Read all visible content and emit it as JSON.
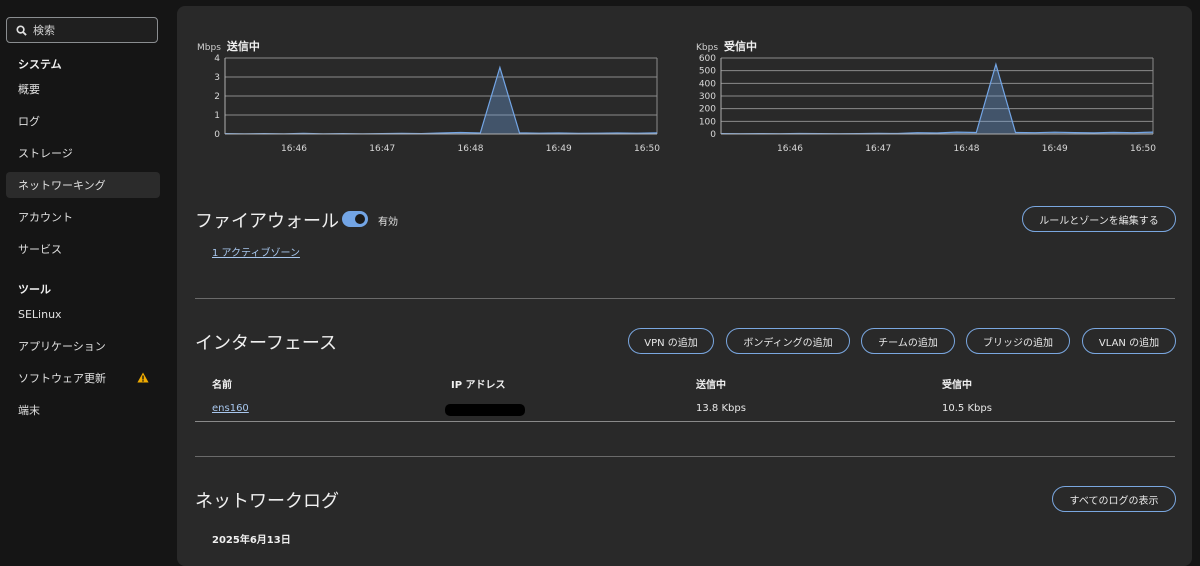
{
  "sidebar": {
    "search_placeholder": "検索",
    "system_heading": "システム",
    "items": [
      {
        "label": "概要"
      },
      {
        "label": "ログ"
      },
      {
        "label": "ストレージ"
      },
      {
        "label": "ネットワーキング"
      },
      {
        "label": "アカウント"
      },
      {
        "label": "サービス"
      }
    ],
    "tools_heading": "ツール",
    "tools": [
      {
        "label": "SELinux"
      },
      {
        "label": "アプリケーション"
      },
      {
        "label": "ソフトウェア更新"
      },
      {
        "label": "端末"
      }
    ],
    "warning_color": "#f0ab00"
  },
  "charts": {
    "send": {
      "unit": "Mbps",
      "title": "送信中"
    },
    "receive": {
      "unit": "Kbps",
      "title": "受信中"
    }
  },
  "chart_data": [
    {
      "type": "area",
      "title": "送信中",
      "ylabel": "Mbps",
      "ylim": [
        0,
        4
      ],
      "yticks": [
        "0",
        "1",
        "2",
        "3",
        "4"
      ],
      "xticks": [
        "16:46",
        "16:47",
        "16:48",
        "16:49",
        "16:50"
      ],
      "series": [
        {
          "values": [
            0.02,
            0.01,
            0.02,
            0.01,
            0.03,
            0.01,
            0.02,
            0.01,
            0.02,
            0.03,
            0.02,
            0.05,
            0.08,
            0.05,
            3.5,
            0.06,
            0.04,
            0.05,
            0.03,
            0.04,
            0.05,
            0.04,
            0.06
          ]
        }
      ],
      "color": "#73a5e5",
      "grid": true
    },
    {
      "type": "area",
      "title": "受信中",
      "ylabel": "Kbps",
      "ylim": [
        0,
        600
      ],
      "yticks": [
        "0",
        "100",
        "200",
        "300",
        "400",
        "500",
        "600"
      ],
      "xticks": [
        "16:46",
        "16:47",
        "16:48",
        "16:49",
        "16:50"
      ],
      "series": [
        {
          "values": [
            3,
            2,
            3,
            2,
            4,
            3,
            2,
            3,
            5,
            4,
            10,
            8,
            15,
            12,
            550,
            12,
            10,
            14,
            11,
            9,
            13,
            10,
            15
          ]
        }
      ],
      "color": "#73a5e5",
      "grid": true
    }
  ],
  "firewall": {
    "title": "ファイアウォール",
    "status": "有効",
    "enabled": true,
    "edit_button": "ルールとゾーンを編集する",
    "zones_link": "1 アクティブゾーン"
  },
  "interfaces": {
    "title": "インターフェース",
    "buttons": [
      "VPN の追加",
      "ボンディングの追加",
      "チームの追加",
      "ブリッジの追加",
      "VLAN の追加"
    ],
    "columns": [
      "名前",
      "IP アドレス",
      "送信中",
      "受信中"
    ],
    "rows": [
      {
        "name": "ens160",
        "sending": "13.8 Kbps",
        "receiving": "10.5 Kbps"
      }
    ]
  },
  "network_log": {
    "title": "ネットワークログ",
    "show_all_button": "すべてのログの表示",
    "date": "2025年6月13日"
  }
}
